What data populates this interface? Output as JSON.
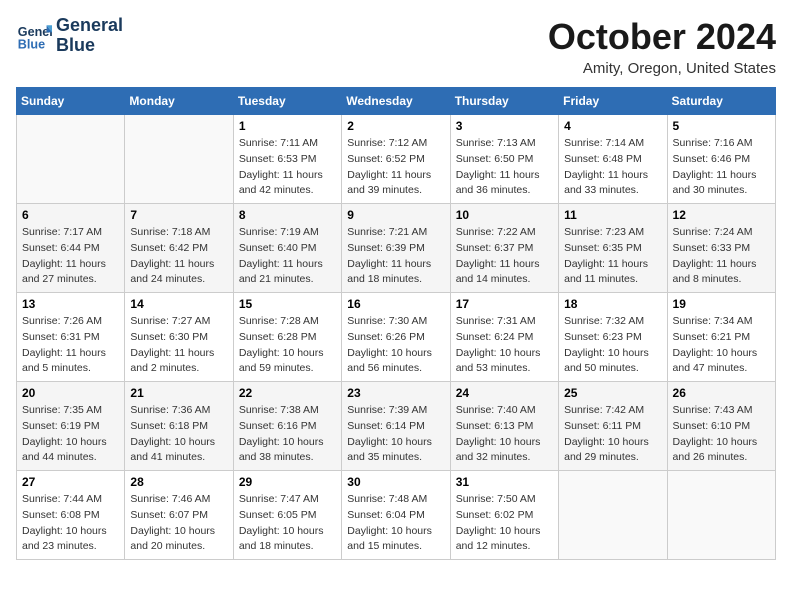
{
  "logo": {
    "line1": "General",
    "line2": "Blue"
  },
  "title": "October 2024",
  "subtitle": "Amity, Oregon, United States",
  "days_header": [
    "Sunday",
    "Monday",
    "Tuesday",
    "Wednesday",
    "Thursday",
    "Friday",
    "Saturday"
  ],
  "weeks": [
    [
      {
        "num": "",
        "sunrise": "",
        "sunset": "",
        "daylight": ""
      },
      {
        "num": "",
        "sunrise": "",
        "sunset": "",
        "daylight": ""
      },
      {
        "num": "1",
        "sunrise": "Sunrise: 7:11 AM",
        "sunset": "Sunset: 6:53 PM",
        "daylight": "Daylight: 11 hours and 42 minutes."
      },
      {
        "num": "2",
        "sunrise": "Sunrise: 7:12 AM",
        "sunset": "Sunset: 6:52 PM",
        "daylight": "Daylight: 11 hours and 39 minutes."
      },
      {
        "num": "3",
        "sunrise": "Sunrise: 7:13 AM",
        "sunset": "Sunset: 6:50 PM",
        "daylight": "Daylight: 11 hours and 36 minutes."
      },
      {
        "num": "4",
        "sunrise": "Sunrise: 7:14 AM",
        "sunset": "Sunset: 6:48 PM",
        "daylight": "Daylight: 11 hours and 33 minutes."
      },
      {
        "num": "5",
        "sunrise": "Sunrise: 7:16 AM",
        "sunset": "Sunset: 6:46 PM",
        "daylight": "Daylight: 11 hours and 30 minutes."
      }
    ],
    [
      {
        "num": "6",
        "sunrise": "Sunrise: 7:17 AM",
        "sunset": "Sunset: 6:44 PM",
        "daylight": "Daylight: 11 hours and 27 minutes."
      },
      {
        "num": "7",
        "sunrise": "Sunrise: 7:18 AM",
        "sunset": "Sunset: 6:42 PM",
        "daylight": "Daylight: 11 hours and 24 minutes."
      },
      {
        "num": "8",
        "sunrise": "Sunrise: 7:19 AM",
        "sunset": "Sunset: 6:40 PM",
        "daylight": "Daylight: 11 hours and 21 minutes."
      },
      {
        "num": "9",
        "sunrise": "Sunrise: 7:21 AM",
        "sunset": "Sunset: 6:39 PM",
        "daylight": "Daylight: 11 hours and 18 minutes."
      },
      {
        "num": "10",
        "sunrise": "Sunrise: 7:22 AM",
        "sunset": "Sunset: 6:37 PM",
        "daylight": "Daylight: 11 hours and 14 minutes."
      },
      {
        "num": "11",
        "sunrise": "Sunrise: 7:23 AM",
        "sunset": "Sunset: 6:35 PM",
        "daylight": "Daylight: 11 hours and 11 minutes."
      },
      {
        "num": "12",
        "sunrise": "Sunrise: 7:24 AM",
        "sunset": "Sunset: 6:33 PM",
        "daylight": "Daylight: 11 hours and 8 minutes."
      }
    ],
    [
      {
        "num": "13",
        "sunrise": "Sunrise: 7:26 AM",
        "sunset": "Sunset: 6:31 PM",
        "daylight": "Daylight: 11 hours and 5 minutes."
      },
      {
        "num": "14",
        "sunrise": "Sunrise: 7:27 AM",
        "sunset": "Sunset: 6:30 PM",
        "daylight": "Daylight: 11 hours and 2 minutes."
      },
      {
        "num": "15",
        "sunrise": "Sunrise: 7:28 AM",
        "sunset": "Sunset: 6:28 PM",
        "daylight": "Daylight: 10 hours and 59 minutes."
      },
      {
        "num": "16",
        "sunrise": "Sunrise: 7:30 AM",
        "sunset": "Sunset: 6:26 PM",
        "daylight": "Daylight: 10 hours and 56 minutes."
      },
      {
        "num": "17",
        "sunrise": "Sunrise: 7:31 AM",
        "sunset": "Sunset: 6:24 PM",
        "daylight": "Daylight: 10 hours and 53 minutes."
      },
      {
        "num": "18",
        "sunrise": "Sunrise: 7:32 AM",
        "sunset": "Sunset: 6:23 PM",
        "daylight": "Daylight: 10 hours and 50 minutes."
      },
      {
        "num": "19",
        "sunrise": "Sunrise: 7:34 AM",
        "sunset": "Sunset: 6:21 PM",
        "daylight": "Daylight: 10 hours and 47 minutes."
      }
    ],
    [
      {
        "num": "20",
        "sunrise": "Sunrise: 7:35 AM",
        "sunset": "Sunset: 6:19 PM",
        "daylight": "Daylight: 10 hours and 44 minutes."
      },
      {
        "num": "21",
        "sunrise": "Sunrise: 7:36 AM",
        "sunset": "Sunset: 6:18 PM",
        "daylight": "Daylight: 10 hours and 41 minutes."
      },
      {
        "num": "22",
        "sunrise": "Sunrise: 7:38 AM",
        "sunset": "Sunset: 6:16 PM",
        "daylight": "Daylight: 10 hours and 38 minutes."
      },
      {
        "num": "23",
        "sunrise": "Sunrise: 7:39 AM",
        "sunset": "Sunset: 6:14 PM",
        "daylight": "Daylight: 10 hours and 35 minutes."
      },
      {
        "num": "24",
        "sunrise": "Sunrise: 7:40 AM",
        "sunset": "Sunset: 6:13 PM",
        "daylight": "Daylight: 10 hours and 32 minutes."
      },
      {
        "num": "25",
        "sunrise": "Sunrise: 7:42 AM",
        "sunset": "Sunset: 6:11 PM",
        "daylight": "Daylight: 10 hours and 29 minutes."
      },
      {
        "num": "26",
        "sunrise": "Sunrise: 7:43 AM",
        "sunset": "Sunset: 6:10 PM",
        "daylight": "Daylight: 10 hours and 26 minutes."
      }
    ],
    [
      {
        "num": "27",
        "sunrise": "Sunrise: 7:44 AM",
        "sunset": "Sunset: 6:08 PM",
        "daylight": "Daylight: 10 hours and 23 minutes."
      },
      {
        "num": "28",
        "sunrise": "Sunrise: 7:46 AM",
        "sunset": "Sunset: 6:07 PM",
        "daylight": "Daylight: 10 hours and 20 minutes."
      },
      {
        "num": "29",
        "sunrise": "Sunrise: 7:47 AM",
        "sunset": "Sunset: 6:05 PM",
        "daylight": "Daylight: 10 hours and 18 minutes."
      },
      {
        "num": "30",
        "sunrise": "Sunrise: 7:48 AM",
        "sunset": "Sunset: 6:04 PM",
        "daylight": "Daylight: 10 hours and 15 minutes."
      },
      {
        "num": "31",
        "sunrise": "Sunrise: 7:50 AM",
        "sunset": "Sunset: 6:02 PM",
        "daylight": "Daylight: 10 hours and 12 minutes."
      },
      {
        "num": "",
        "sunrise": "",
        "sunset": "",
        "daylight": ""
      },
      {
        "num": "",
        "sunrise": "",
        "sunset": "",
        "daylight": ""
      }
    ]
  ]
}
